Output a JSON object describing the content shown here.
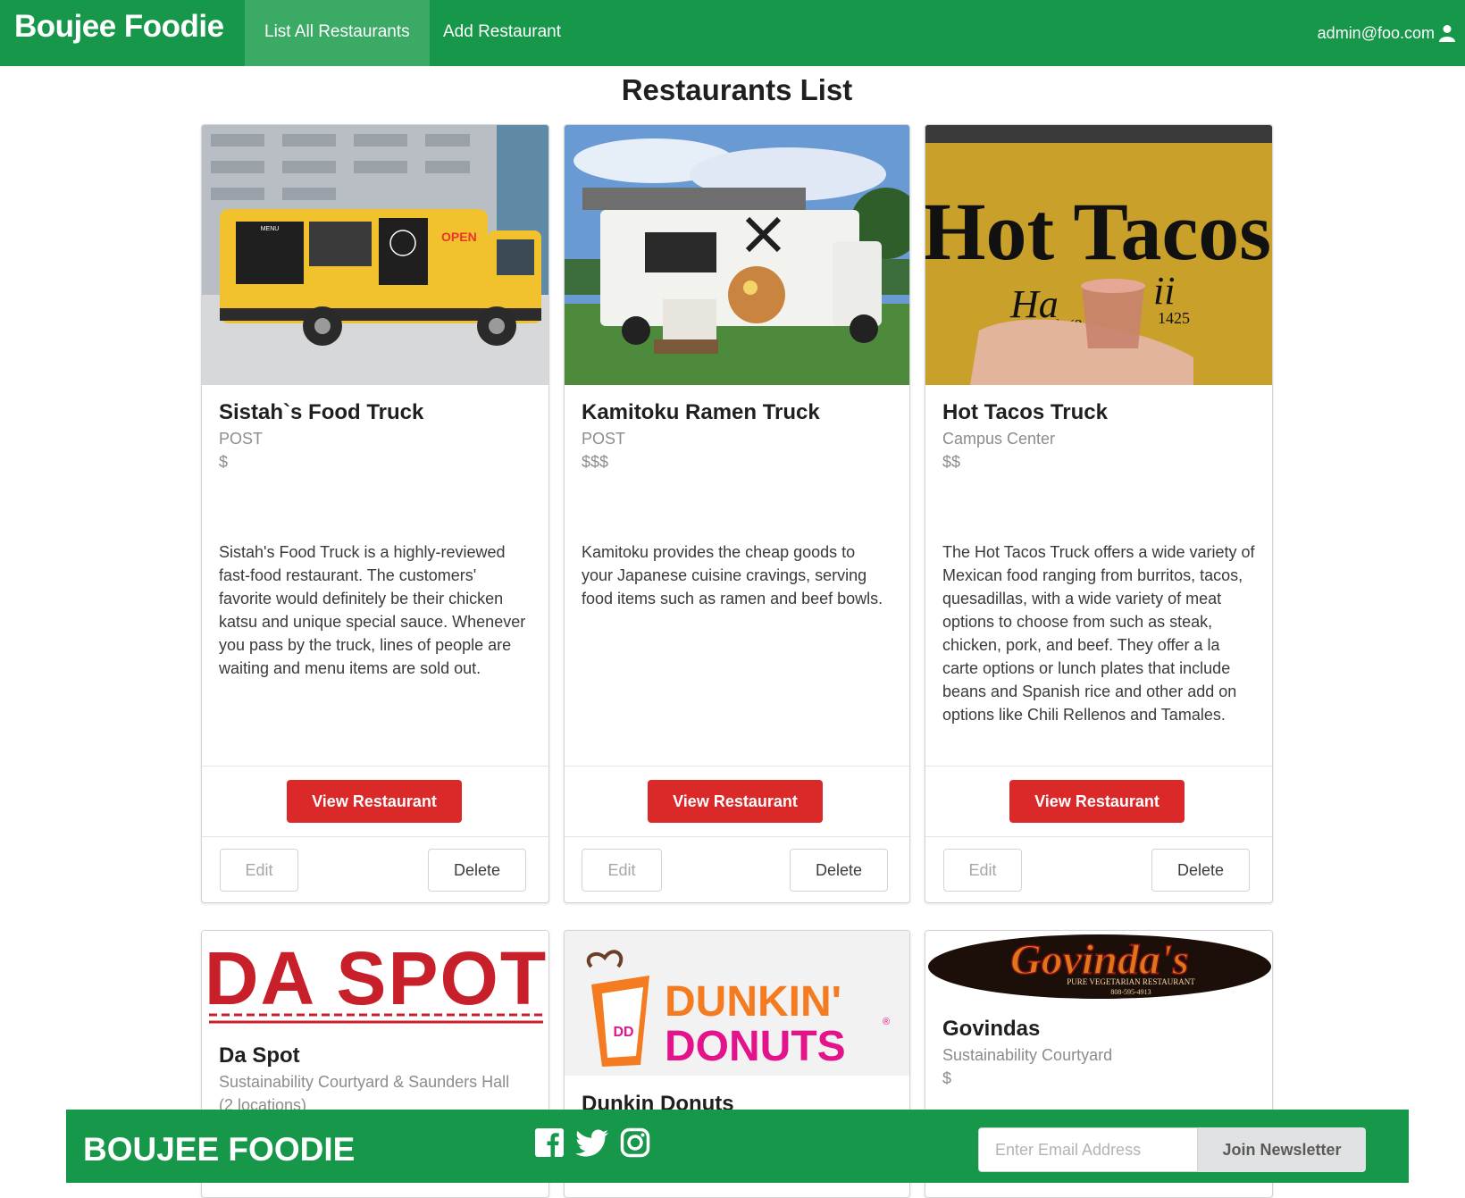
{
  "navbar": {
    "brand": "Boujee Foodie",
    "items": [
      {
        "label": "List All Restaurants",
        "active": true
      },
      {
        "label": "Add Restaurant",
        "active": false
      }
    ],
    "user": "admin@foo.com",
    "user_icon": "user-icon"
  },
  "page": {
    "title": "Restaurants List"
  },
  "restaurants": [
    {
      "name": "Sistah`s Food Truck",
      "location": "POST",
      "price": "$",
      "description": "Sistah's Food Truck is a highly-reviewed fast-food restaurant. The customers' favorite would definitely be their chicken katsu and unique special sauce. Whenever you pass by the truck, lines of people are waiting and menu items are sold out.",
      "image_text": [
        "MENU",
        "OPEN"
      ],
      "view_label": "View Restaurant",
      "edit_label": "Edit",
      "delete_label": "Delete"
    },
    {
      "name": "Kamitoku Ramen Truck",
      "location": "POST",
      "price": "$$$",
      "description": "Kamitoku provides the cheap goods to your Japanese cuisine cravings, serving food items such as ramen and beef bowls.",
      "view_label": "View Restaurant",
      "edit_label": "Edit",
      "delete_label": "Delete"
    },
    {
      "name": "Hot Tacos Truck",
      "location": "Campus Center",
      "price": "$$",
      "description": "The Hot Tacos Truck offers a wide variety of Mexican food ranging from burritos, tacos, quesadillas, with a wide variety of meat options to choose from such as steak, chicken, pork, and beef. They offer a la carte options or lunch plates that include beans and Spanish rice and other add on options like Chili Rellenos and Tamales.",
      "image_text": [
        "Hot Tacos",
        "Ha",
        "ii",
        "tel: (8",
        "1425"
      ],
      "view_label": "View Restaurant",
      "edit_label": "Edit",
      "delete_label": "Delete"
    },
    {
      "name": "Da Spot",
      "location": "Sustainability Courtyard & Saunders Hall",
      "location_extra": "(2 locations)",
      "image_text": [
        "DA SPOT"
      ]
    },
    {
      "name": "Dunkin Donuts",
      "image_text": [
        "DUNKIN'",
        "DONUTS",
        "DD",
        "®"
      ]
    },
    {
      "name": "Govindas",
      "location": "Sustainability Courtyard",
      "price": "$",
      "image_text": [
        "Govinda's",
        "PURE VEGETARIAN RESTAURANT",
        "808-595-4913"
      ]
    }
  ],
  "footer": {
    "brand": "BOUJEE FOODIE",
    "social_icons": [
      "facebook-icon",
      "twitter-icon",
      "instagram-icon"
    ],
    "email_placeholder": "Enter Email Address",
    "join_label": "Join Newsletter"
  },
  "colors": {
    "brand_green": "#16974a",
    "active_nav": "#3aaa65",
    "primary_red": "#db2828"
  }
}
